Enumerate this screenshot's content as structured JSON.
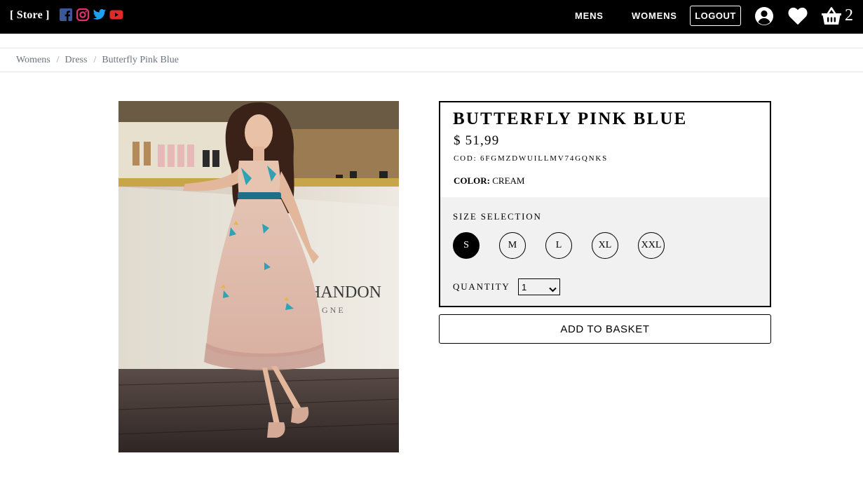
{
  "header": {
    "brand": "[ Store ]",
    "social_icons": [
      "facebook-icon",
      "instagram-icon",
      "twitter-icon",
      "youtube-icon"
    ],
    "nav": {
      "mens": "MENS",
      "womens": "WOMENS",
      "logout": "LOGOUT"
    },
    "cart_count": "2",
    "colors": {
      "background": "#000000",
      "facebook": "#3b5998",
      "instagram": "#e1306c",
      "twitter": "#1da1f2",
      "youtube": "#e02a2a"
    }
  },
  "breadcrumb": [
    {
      "label": "Womens"
    },
    {
      "label": "Dress"
    },
    {
      "label": "Butterfly Pink Blue"
    }
  ],
  "breadcrumb_separator": "/",
  "product": {
    "title": "BUTTERFLY PINK BLUE",
    "price": "$ 51,99",
    "code": "COD: 6FGMZDWUILLMV74GQNKS",
    "color_label": "COLOR:",
    "color_value": "CREAM",
    "size_label": "SIZE SELECTION",
    "sizes": [
      "S",
      "M",
      "L",
      "XL",
      "XXL"
    ],
    "selected_size": "S",
    "quantity_label": "QUANTITY",
    "quantity_value": "1",
    "add_to_basket": "ADD TO BASKET"
  }
}
